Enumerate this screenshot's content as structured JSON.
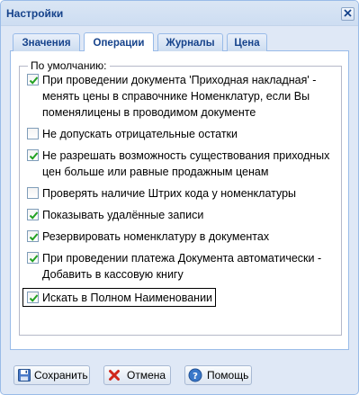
{
  "window": {
    "title": "Настройки"
  },
  "tabs": [
    {
      "label": "Значения",
      "active": false
    },
    {
      "label": "Операции",
      "active": true
    },
    {
      "label": "Журналы",
      "active": false
    },
    {
      "label": "Цена",
      "active": false
    }
  ],
  "group": {
    "legend": "По умолчанию:"
  },
  "options": [
    {
      "label": "При проведении документа 'Приходная накладная' - менять цены в справочнике Номенклатур, если Вы поменялицены в проводимом документе",
      "checked": true
    },
    {
      "label": "Не допускать отрицательные остатки",
      "checked": false
    },
    {
      "label": "Не разрешать возможность существования приходных цен больше или равные продажным ценам",
      "checked": true
    },
    {
      "label": "Проверять наличие Штрих кода у номенклатуры",
      "checked": false
    },
    {
      "label": "Показывать удалённые записи",
      "checked": true
    },
    {
      "label": "Резервировать номенклатуру в документах",
      "checked": true
    },
    {
      "label": "При проведении платежа Документа автоматически - Добавить в кассовую книгу",
      "checked": true
    },
    {
      "label": "Искать в Полном Наименовании",
      "checked": true
    }
  ],
  "buttons": {
    "save": {
      "label": "Сохранить",
      "icon": "floppy-disk-icon"
    },
    "cancel": {
      "label": "Отмена",
      "icon": "red-x-icon"
    },
    "help": {
      "label": "Помощь",
      "icon": "help-icon"
    }
  },
  "colors": {
    "title_text": "#15428b",
    "window_bg": "#dfe8f6",
    "border": "#99bbe8"
  }
}
